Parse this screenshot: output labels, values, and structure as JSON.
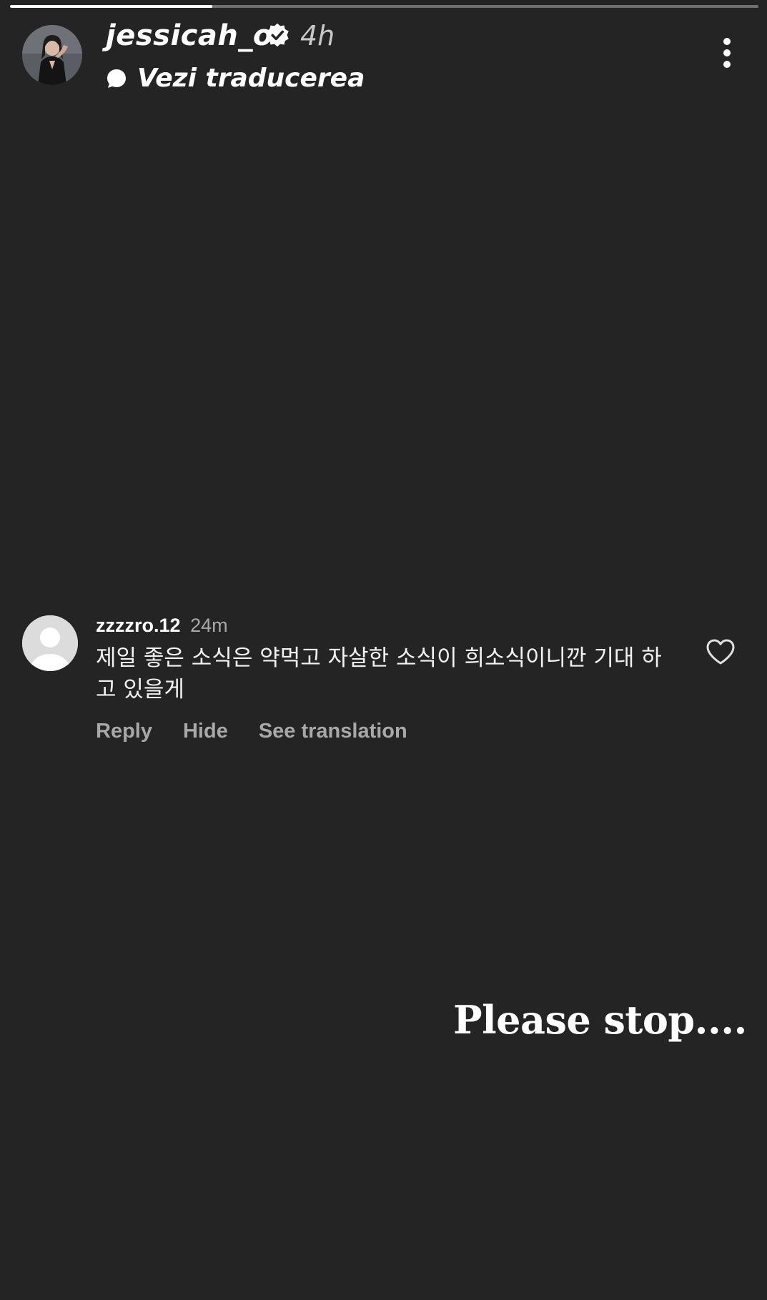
{
  "story": {
    "progress": 0.27,
    "username": "jessicah_o",
    "time_ago": "4h",
    "translate_label": "Vezi traducerea"
  },
  "comment": {
    "username": "zzzzro.12",
    "time_ago": "24m",
    "text": "제일 좋은 소식은 약먹고 자살한 소식이 희소식이니깐 기대 하고 있을게",
    "actions": {
      "reply": "Reply",
      "hide": "Hide",
      "see_translation": "See translation"
    }
  },
  "caption": "Please stop....",
  "icons": {
    "verified": "verified-badge-icon",
    "translate": "speech-bubble-icon",
    "more": "more-vertical-icon",
    "like": "heart-icon",
    "avatar_placeholder": "default-avatar-icon"
  },
  "colors": {
    "background": "#242424",
    "text_primary": "#ffffff",
    "text_secondary": "#a8a8a8"
  }
}
